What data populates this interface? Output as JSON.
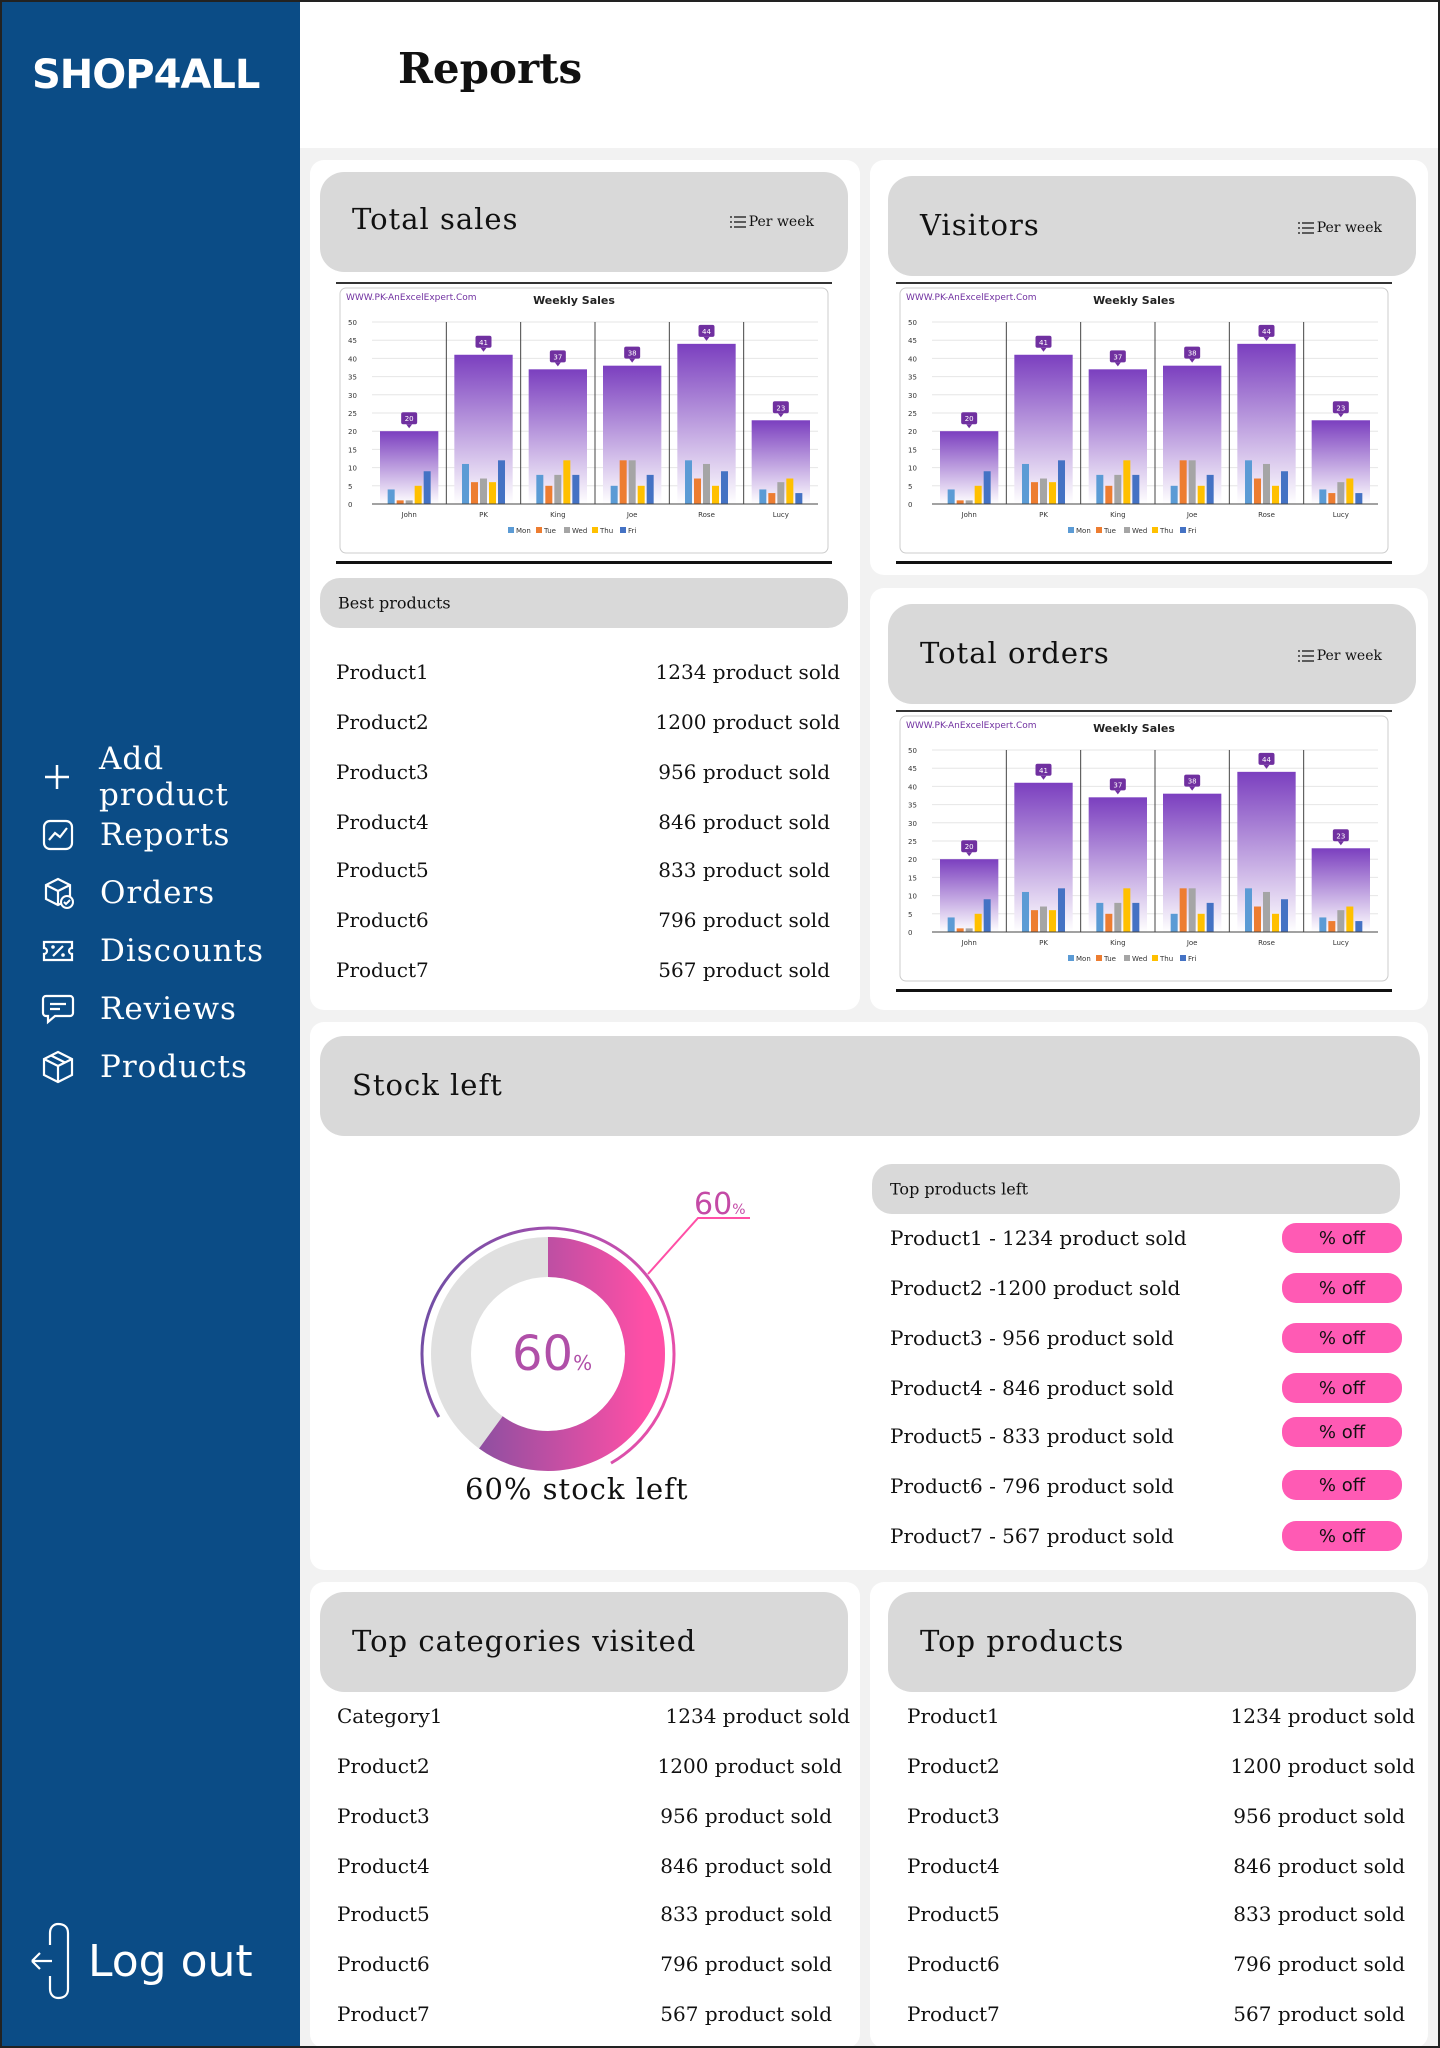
{
  "brand": {
    "logo": "SHOP4ALL"
  },
  "header": {
    "title": "Reports"
  },
  "nav": {
    "items": [
      {
        "label": "Add product",
        "icon": "plus-icon"
      },
      {
        "label": "Reports",
        "icon": "chart-icon"
      },
      {
        "label": "Orders",
        "icon": "box-check-icon"
      },
      {
        "label": "Discounts",
        "icon": "discount-ticket-icon"
      },
      {
        "label": "Reviews",
        "icon": "chat-icon"
      },
      {
        "label": "Products",
        "icon": "cube-icon"
      }
    ],
    "logout": "Log out"
  },
  "per_week": "Per week",
  "total_sales": {
    "title": "Total sales"
  },
  "visitors": {
    "title": "Visitors"
  },
  "total_orders": {
    "title": "Total orders"
  },
  "best_products": {
    "title": "Best products",
    "rows": [
      {
        "name": "Product1",
        "value": "1234 product sold"
      },
      {
        "name": "Product2",
        "value": "1200 product sold"
      },
      {
        "name": "Product3",
        "value": "956 product sold"
      },
      {
        "name": "Product4",
        "value": "846 product sold"
      },
      {
        "name": "Product5",
        "value": "833 product sold"
      },
      {
        "name": "Product6",
        "value": "796 product sold"
      },
      {
        "name": "Product7",
        "value": "567 product sold"
      }
    ]
  },
  "stock_left": {
    "title": "Stock left",
    "percent_label": "60",
    "percent_sign": "%",
    "caption": "60% stock left",
    "percent_value": 60,
    "top_left_title": "Top products left",
    "discount_label": "% off",
    "rows": [
      "Product1 - 1234 product sold",
      "Product2 -1200 product sold",
      "Product3 - 956 product sold",
      "Product4 - 846 product sold",
      "Product5 - 833 product sold",
      "Product6 - 796 product sold",
      "Product7 - 567 product sold"
    ]
  },
  "top_categories": {
    "title": "Top categories visited",
    "rows": [
      {
        "name": "Category1",
        "value": "1234 product sold"
      },
      {
        "name": "Product2",
        "value": "1200 product sold"
      },
      {
        "name": "Product3",
        "value": "956 product sold"
      },
      {
        "name": "Product4",
        "value": "846 product sold"
      },
      {
        "name": "Product5",
        "value": "833 product sold"
      },
      {
        "name": "Product6",
        "value": "796 product sold"
      },
      {
        "name": "Product7",
        "value": "567 product sold"
      }
    ]
  },
  "top_products": {
    "title": "Top products",
    "rows": [
      {
        "name": "Product1",
        "value": "1234 product sold"
      },
      {
        "name": "Product2",
        "value": "1200 product sold"
      },
      {
        "name": "Product3",
        "value": "956 product sold"
      },
      {
        "name": "Product4",
        "value": "846 product sold"
      },
      {
        "name": "Product5",
        "value": "833 product sold"
      },
      {
        "name": "Product6",
        "value": "796 product sold"
      },
      {
        "name": "Product7",
        "value": "567 product sold"
      }
    ]
  },
  "colors": {
    "sidebar": "#0b4c86",
    "pill": "#d9d9d9",
    "discount": "#ff5ab4",
    "donut_purple": "#7b4fa0",
    "donut_pink": "#ff4fa6",
    "donut_gray": "#e0e0e0"
  },
  "chart_data": {
    "type": "bar",
    "site_label": "WWW.PK-AnExcelExpert.Com",
    "title": "Weekly Sales",
    "categories": [
      "John",
      "PK",
      "King",
      "Joe",
      "Rose",
      "Lucy"
    ],
    "totals": [
      20,
      41,
      37,
      38,
      44,
      23
    ],
    "series": [
      {
        "name": "Mon",
        "values": [
          4,
          11,
          8,
          5,
          12,
          4
        ]
      },
      {
        "name": "Tue",
        "values": [
          1,
          6,
          5,
          12,
          7,
          3
        ]
      },
      {
        "name": "Wed",
        "values": [
          1,
          7,
          8,
          12,
          11,
          6
        ]
      },
      {
        "name": "Thu",
        "values": [
          5,
          6,
          12,
          5,
          5,
          7
        ]
      },
      {
        "name": "Fri",
        "values": [
          9,
          12,
          8,
          8,
          9,
          3
        ]
      }
    ],
    "series_colors": [
      "#5b9bd5",
      "#ed7d31",
      "#a5a5a5",
      "#ffc000",
      "#4472c4"
    ],
    "ylim": [
      0,
      50
    ],
    "yticks": [
      0,
      5,
      10,
      15,
      20,
      25,
      30,
      35,
      40,
      45,
      50
    ],
    "legend": "bottom"
  }
}
